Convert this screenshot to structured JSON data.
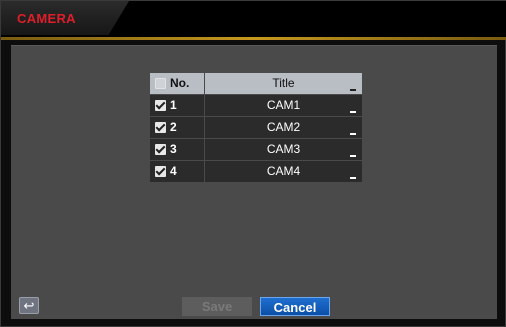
{
  "window": {
    "title": "CAMERA"
  },
  "table": {
    "headers": {
      "no": "No.",
      "title": "Title"
    },
    "rows": [
      {
        "no": "1",
        "title": "CAM1",
        "checked": true
      },
      {
        "no": "2",
        "title": "CAM2",
        "checked": true
      },
      {
        "no": "3",
        "title": "CAM3",
        "checked": true
      },
      {
        "no": "4",
        "title": "CAM4",
        "checked": true
      }
    ]
  },
  "buttons": {
    "back_icon": "↩",
    "save": "Save",
    "cancel": "Cancel"
  },
  "colors": {
    "tab_text": "#e01e2a",
    "accent_line": "#c7981f",
    "cancel_button": "#1f6fd0"
  }
}
